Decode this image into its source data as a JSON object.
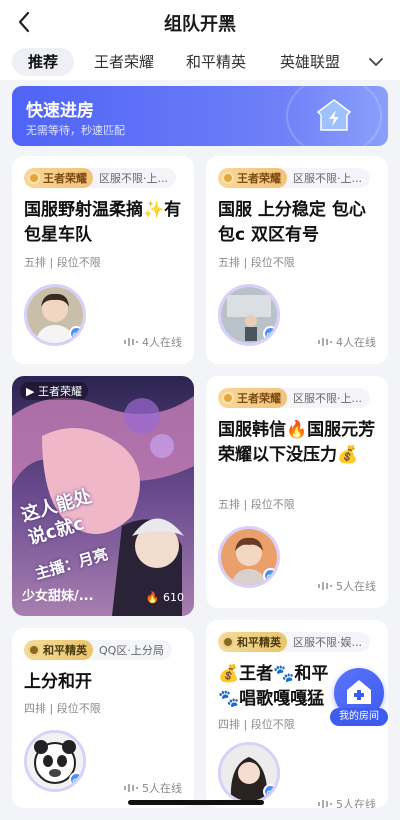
{
  "header": {
    "title": "组队开黑"
  },
  "tabs": [
    "推荐",
    "王者荣耀",
    "和平精英",
    "英雄联盟"
  ],
  "quick_match": {
    "title": "快速进房",
    "subtitle": "无需等待，秒速匹配"
  },
  "rooms": [
    {
      "game": "王者荣耀",
      "region": "区服不限·上...",
      "title": "国服野射温柔摘✨有包星车队",
      "meta": "五排 | 段位不限",
      "online": "4人在线"
    },
    {
      "game": "王者荣耀",
      "region": "区服不限·上...",
      "title": "国服 上分稳定  包心包c 双区有号",
      "meta": "五排 | 段位不限",
      "online": "4人在线"
    },
    {
      "game": "王者荣耀",
      "region": "区服不限·上...",
      "title": "国服韩信🔥国服元芳 荣耀以下没压力💰",
      "meta": "五排 | 段位不限",
      "online": "5人在线"
    },
    {
      "game": "和平精英",
      "region": "QQ区·上分局",
      "title": "上分和开",
      "meta": "四排 | 段位不限",
      "online": "5人在线"
    },
    {
      "game": "和平精英",
      "region": "区服不限·娱...",
      "title": "💰王者🐾和平🐾唱歌嘎嘎猛",
      "meta": "四排 | 段位不限",
      "online": "5人在线"
    }
  ],
  "featured": {
    "tag": "王者荣耀",
    "poster_text": "这人能处\n说c就c",
    "host_label": "主播：月亮",
    "caption": "少女甜妹/...",
    "likes": "610"
  },
  "fab": {
    "label": "我的房间"
  },
  "icons": {
    "back": "chevron-left-icon",
    "more": "chevron-down-icon",
    "gender": "male-icon",
    "online": "sound-wave-icon",
    "home": "house-plus-icon"
  },
  "colors": {
    "accent": "#4f63f6",
    "badge_gold": "#f2c27a",
    "gender_blue": "#4f8ef7"
  }
}
